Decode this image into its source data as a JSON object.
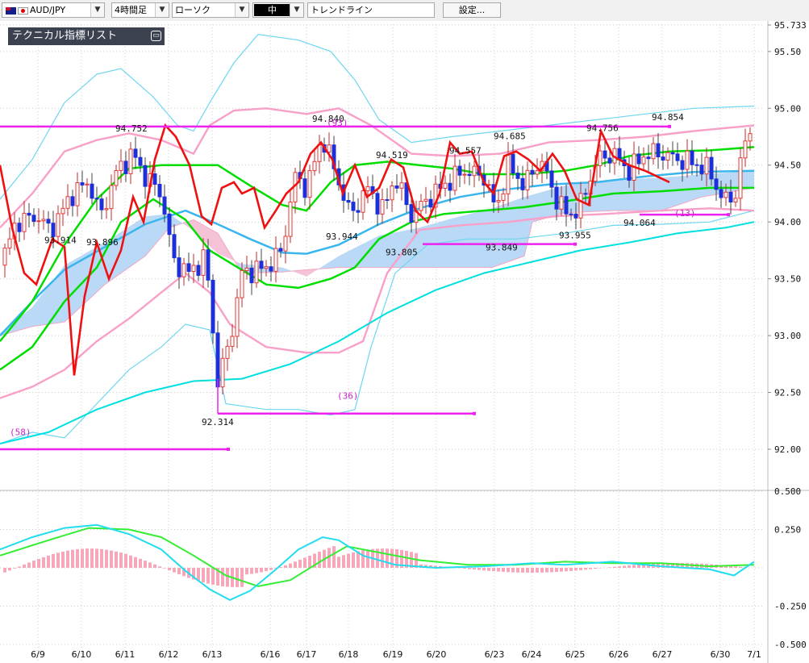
{
  "toolbar": {
    "symbol": "AUD/JPY",
    "timeframe": "4時間足",
    "chart_type": "ローソク",
    "line_width": "中",
    "drawing_tool": "トレンドライン",
    "settings_label": "設定..."
  },
  "indicator_panel": {
    "label": "テクニカル指標リスト"
  },
  "colors": {
    "bull": "#e53935",
    "bear": "#1c2fd8",
    "ema_short": "#00dd00",
    "ema_long": "#00e0e0",
    "sma": "#39b6ee",
    "rsi": "#ee1111",
    "bollinger_outer": "#6ed6f0",
    "bollinger_inner": "#f8a0c8",
    "cloud_bull": "#b9d9f7",
    "cloud_bear": "#f6c2d8",
    "trendline": "#ee22ee",
    "macd": "#22ddee",
    "signal": "#33ee33",
    "histogram": "#f6a7b9"
  },
  "chart_data": {
    "type": "candlestick",
    "instrument": "AUD/JPY",
    "timeframe": "4時間足",
    "price_ticks": [
      "95.733",
      "95.50",
      "95.00",
      "94.50",
      "94.00",
      "93.50",
      "93.00",
      "92.50",
      "92.00"
    ],
    "price_range": [
      91.68,
      95.8
    ],
    "x_labels": [
      "6/9",
      "6/10",
      "6/11",
      "6/12",
      "6/13",
      "6/16",
      "6/17",
      "6/18",
      "6/19",
      "6/20",
      "6/23",
      "6/24",
      "6/25",
      "6/26",
      "6/27",
      "6/30",
      "7/1"
    ],
    "annotations": [
      {
        "text": "94.752",
        "price": 94.752
      },
      {
        "text": "94.840",
        "price": 94.84
      },
      {
        "text": "94.519",
        "price": 94.519
      },
      {
        "text": "94.557",
        "price": 94.557
      },
      {
        "text": "94.685",
        "price": 94.685
      },
      {
        "text": "94.756",
        "price": 94.756
      },
      {
        "text": "94.854",
        "price": 94.854
      },
      {
        "text": "93.914",
        "price": 93.914
      },
      {
        "text": "93.896",
        "price": 93.896
      },
      {
        "text": "93.944",
        "price": 93.944
      },
      {
        "text": "93.805",
        "price": 93.805
      },
      {
        "text": "93.849",
        "price": 93.849
      },
      {
        "text": "93.955",
        "price": 93.955
      },
      {
        "text": "94.064",
        "price": 94.064
      },
      {
        "text": "92.314",
        "price": 92.314
      },
      {
        "text": "(93)",
        "price": 94.83
      },
      {
        "text": "(36)",
        "price": 92.4
      },
      {
        "text": "(58)",
        "price": 92.08
      },
      {
        "text": "(13)",
        "price": 94.08
      }
    ],
    "horizontal_lines": [
      94.84,
      92.314,
      92.0,
      93.805,
      94.064
    ],
    "oscillator": {
      "ticks": [
        "0.500",
        "0.250",
        "-0.250",
        "-0.500"
      ],
      "range": [
        -0.5,
        0.5
      ]
    }
  }
}
